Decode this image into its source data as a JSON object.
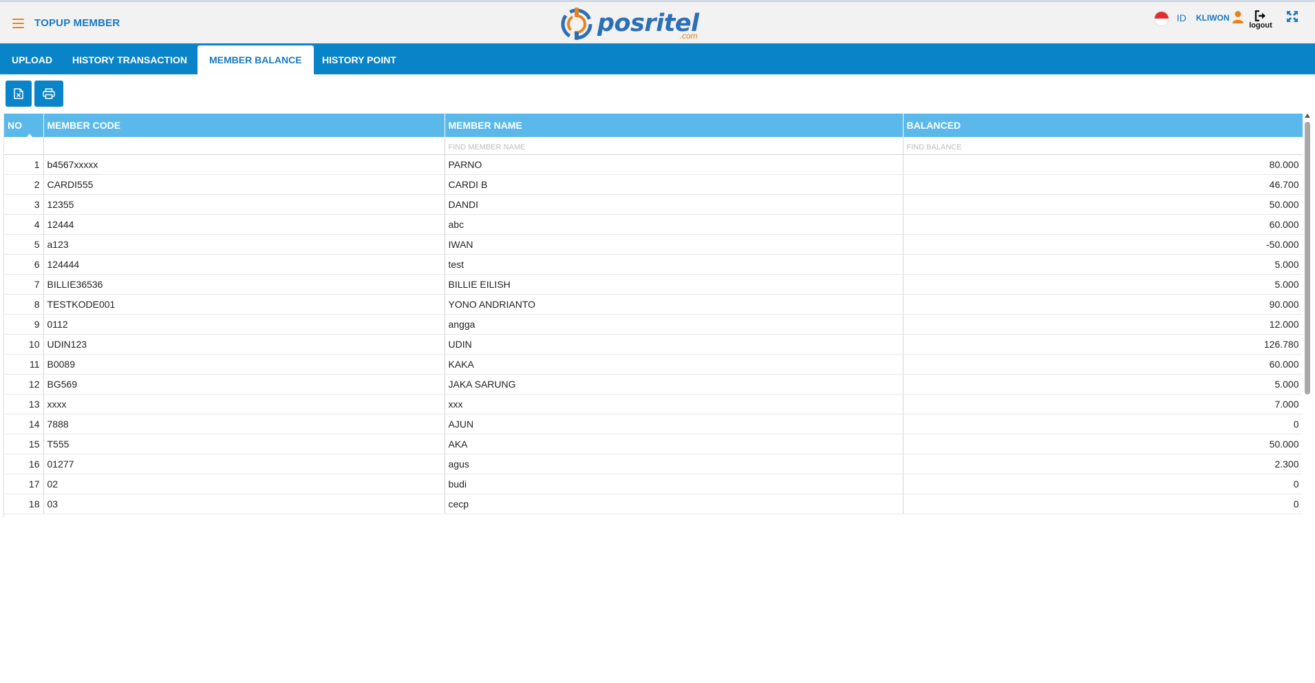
{
  "header": {
    "title": "TOPUP MEMBER",
    "logo_text": "posritel",
    "logo_suffix": ".com",
    "lang": "ID",
    "username": "KLIWON",
    "logout_label": "logout"
  },
  "tabs": [
    {
      "label": "UPLOAD"
    },
    {
      "label": "HISTORY TRANSACTION"
    },
    {
      "label": "MEMBER BALANCE",
      "active": true
    },
    {
      "label": "HISTORY POINT"
    }
  ],
  "table": {
    "columns": [
      "NO",
      "MEMBER CODE",
      "MEMBER NAME",
      "BALANCED"
    ],
    "filters": {
      "member_name_placeholder": "FIND MEMBER NAME",
      "balance_placeholder": "FIND BALANCE"
    },
    "rows": [
      {
        "no": "1",
        "code": "b4567xxxxx",
        "name": "PARNO",
        "balance": "80.000"
      },
      {
        "no": "2",
        "code": "CARDI555",
        "name": "CARDI B",
        "balance": "46.700"
      },
      {
        "no": "3",
        "code": "12355",
        "name": "DANDI",
        "balance": "50.000"
      },
      {
        "no": "4",
        "code": "12444",
        "name": "abc",
        "balance": "60.000"
      },
      {
        "no": "5",
        "code": "a123",
        "name": "IWAN",
        "balance": "-50.000"
      },
      {
        "no": "6",
        "code": "124444",
        "name": "test",
        "balance": "5.000"
      },
      {
        "no": "7",
        "code": "BILLIE36536",
        "name": "BILLIE EILISH",
        "balance": "5.000"
      },
      {
        "no": "8",
        "code": "TESTKODE001",
        "name": "YONO ANDRIANTO",
        "balance": "90.000"
      },
      {
        "no": "9",
        "code": "0112",
        "name": "angga",
        "balance": "12.000"
      },
      {
        "no": "10",
        "code": "UDIN123",
        "name": "UDIN",
        "balance": "126.780"
      },
      {
        "no": "11",
        "code": "B0089",
        "name": "KAKA",
        "balance": "60.000"
      },
      {
        "no": "12",
        "code": "BG569",
        "name": "JAKA SARUNG",
        "balance": "5.000"
      },
      {
        "no": "13",
        "code": "xxxx",
        "name": "xxx",
        "balance": "7.000"
      },
      {
        "no": "14",
        "code": "7888",
        "name": "AJUN",
        "balance": "0"
      },
      {
        "no": "15",
        "code": "T555",
        "name": "AKA",
        "balance": "50.000"
      },
      {
        "no": "16",
        "code": "01277",
        "name": "agus",
        "balance": "2.300"
      },
      {
        "no": "17",
        "code": "02",
        "name": "budi",
        "balance": "0"
      },
      {
        "no": "18",
        "code": "03",
        "name": "cecp",
        "balance": "0"
      }
    ]
  },
  "colors": {
    "primary": "#0a84c8",
    "header_bg": "#5ab8ea",
    "accent": "#e8821e"
  }
}
